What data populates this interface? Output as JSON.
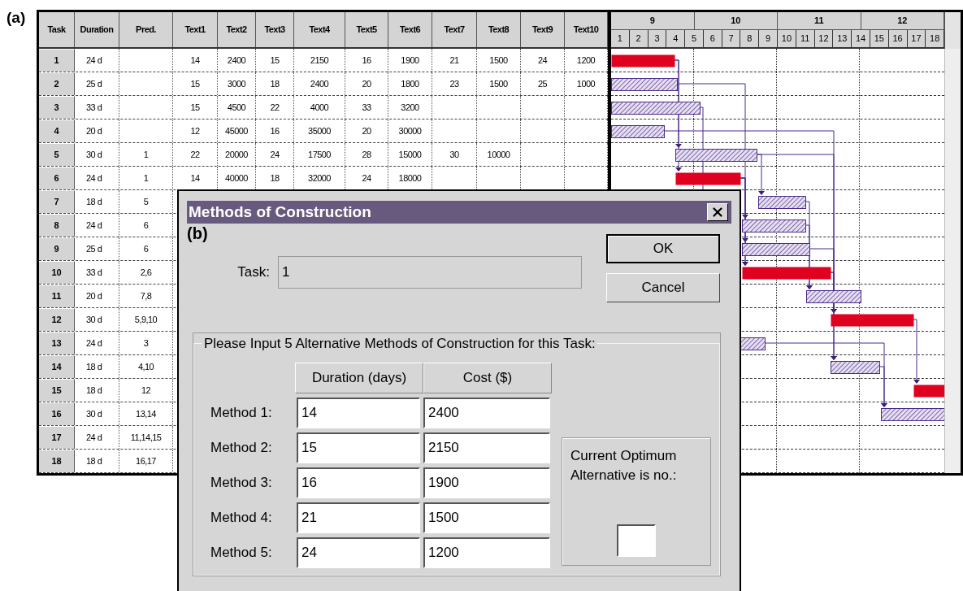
{
  "panel_label": "(a)",
  "table": {
    "columns": [
      "Task",
      "Duration",
      "Pred.",
      "Text1",
      "Text2",
      "Text3",
      "Text4",
      "Text5",
      "Text6",
      "Text7",
      "Text8",
      "Text9",
      "Text10"
    ],
    "rows": [
      {
        "cells": [
          "1",
          "24 d",
          "",
          "14",
          "2400",
          "15",
          "2150",
          "16",
          "1900",
          "21",
          "1500",
          "24",
          "1200"
        ]
      },
      {
        "cells": [
          "2",
          "25 d",
          "",
          "15",
          "3000",
          "18",
          "2400",
          "20",
          "1800",
          "23",
          "1500",
          "25",
          "1000"
        ]
      },
      {
        "cells": [
          "3",
          "33 d",
          "",
          "15",
          "4500",
          "22",
          "4000",
          "33",
          "3200",
          "",
          "",
          "",
          ""
        ]
      },
      {
        "cells": [
          "4",
          "20 d",
          "",
          "12",
          "45000",
          "16",
          "35000",
          "20",
          "30000",
          "",
          "",
          "",
          ""
        ]
      },
      {
        "cells": [
          "5",
          "30 d",
          "1",
          "22",
          "20000",
          "24",
          "17500",
          "28",
          "15000",
          "30",
          "10000",
          "",
          ""
        ]
      },
      {
        "cells": [
          "6",
          "24 d",
          "1",
          "14",
          "40000",
          "18",
          "32000",
          "24",
          "18000",
          "",
          "",
          "",
          ""
        ]
      },
      {
        "cells": [
          "7",
          "18 d",
          "5"
        ]
      },
      {
        "cells": [
          "8",
          "24 d",
          "6"
        ]
      },
      {
        "cells": [
          "9",
          "25 d",
          "6"
        ]
      },
      {
        "cells": [
          "10",
          "33 d",
          "2,6"
        ]
      },
      {
        "cells": [
          "11",
          "20 d",
          "7,8"
        ]
      },
      {
        "cells": [
          "12",
          "30 d",
          "5,9,10"
        ]
      },
      {
        "cells": [
          "13",
          "24 d",
          "3"
        ]
      },
      {
        "cells": [
          "14",
          "18 d",
          "4,10"
        ]
      },
      {
        "cells": [
          "15",
          "18 d",
          "12"
        ]
      },
      {
        "cells": [
          "16",
          "30 d",
          "13,14"
        ]
      },
      {
        "cells": [
          "17",
          "24 d",
          "11,14,15"
        ]
      },
      {
        "cells": [
          "18",
          "18 d",
          "16,17"
        ]
      }
    ]
  },
  "gantt": {
    "weeks": [
      "9",
      "10",
      "11",
      "12"
    ],
    "days": [
      "1",
      "2",
      "3",
      "4",
      "5",
      "6",
      "7",
      "8",
      "9",
      "10",
      "11",
      "12",
      "13",
      "14",
      "15",
      "16",
      "17",
      "18"
    ]
  },
  "dialog": {
    "title": "Methods of Construction",
    "panel_label": "(b)",
    "ok": "OK",
    "cancel": "Cancel",
    "task_label": "Task:",
    "task_value": "1",
    "group_title": "Please Input 5 Alternative Methods of Construction for this Task:",
    "columns": [
      "Duration (days)",
      "Cost ($)"
    ],
    "methods": [
      {
        "label": "Method 1:",
        "duration": "14",
        "cost": "2400"
      },
      {
        "label": "Method 2:",
        "duration": "15",
        "cost": "2150"
      },
      {
        "label": "Method 3:",
        "duration": "16",
        "cost": "1900"
      },
      {
        "label": "Method 4:",
        "duration": "21",
        "cost": "1500"
      },
      {
        "label": "Method 5:",
        "duration": "24",
        "cost": "1200"
      }
    ],
    "optimum_label": "Current Optimum Alternative is no.:"
  }
}
